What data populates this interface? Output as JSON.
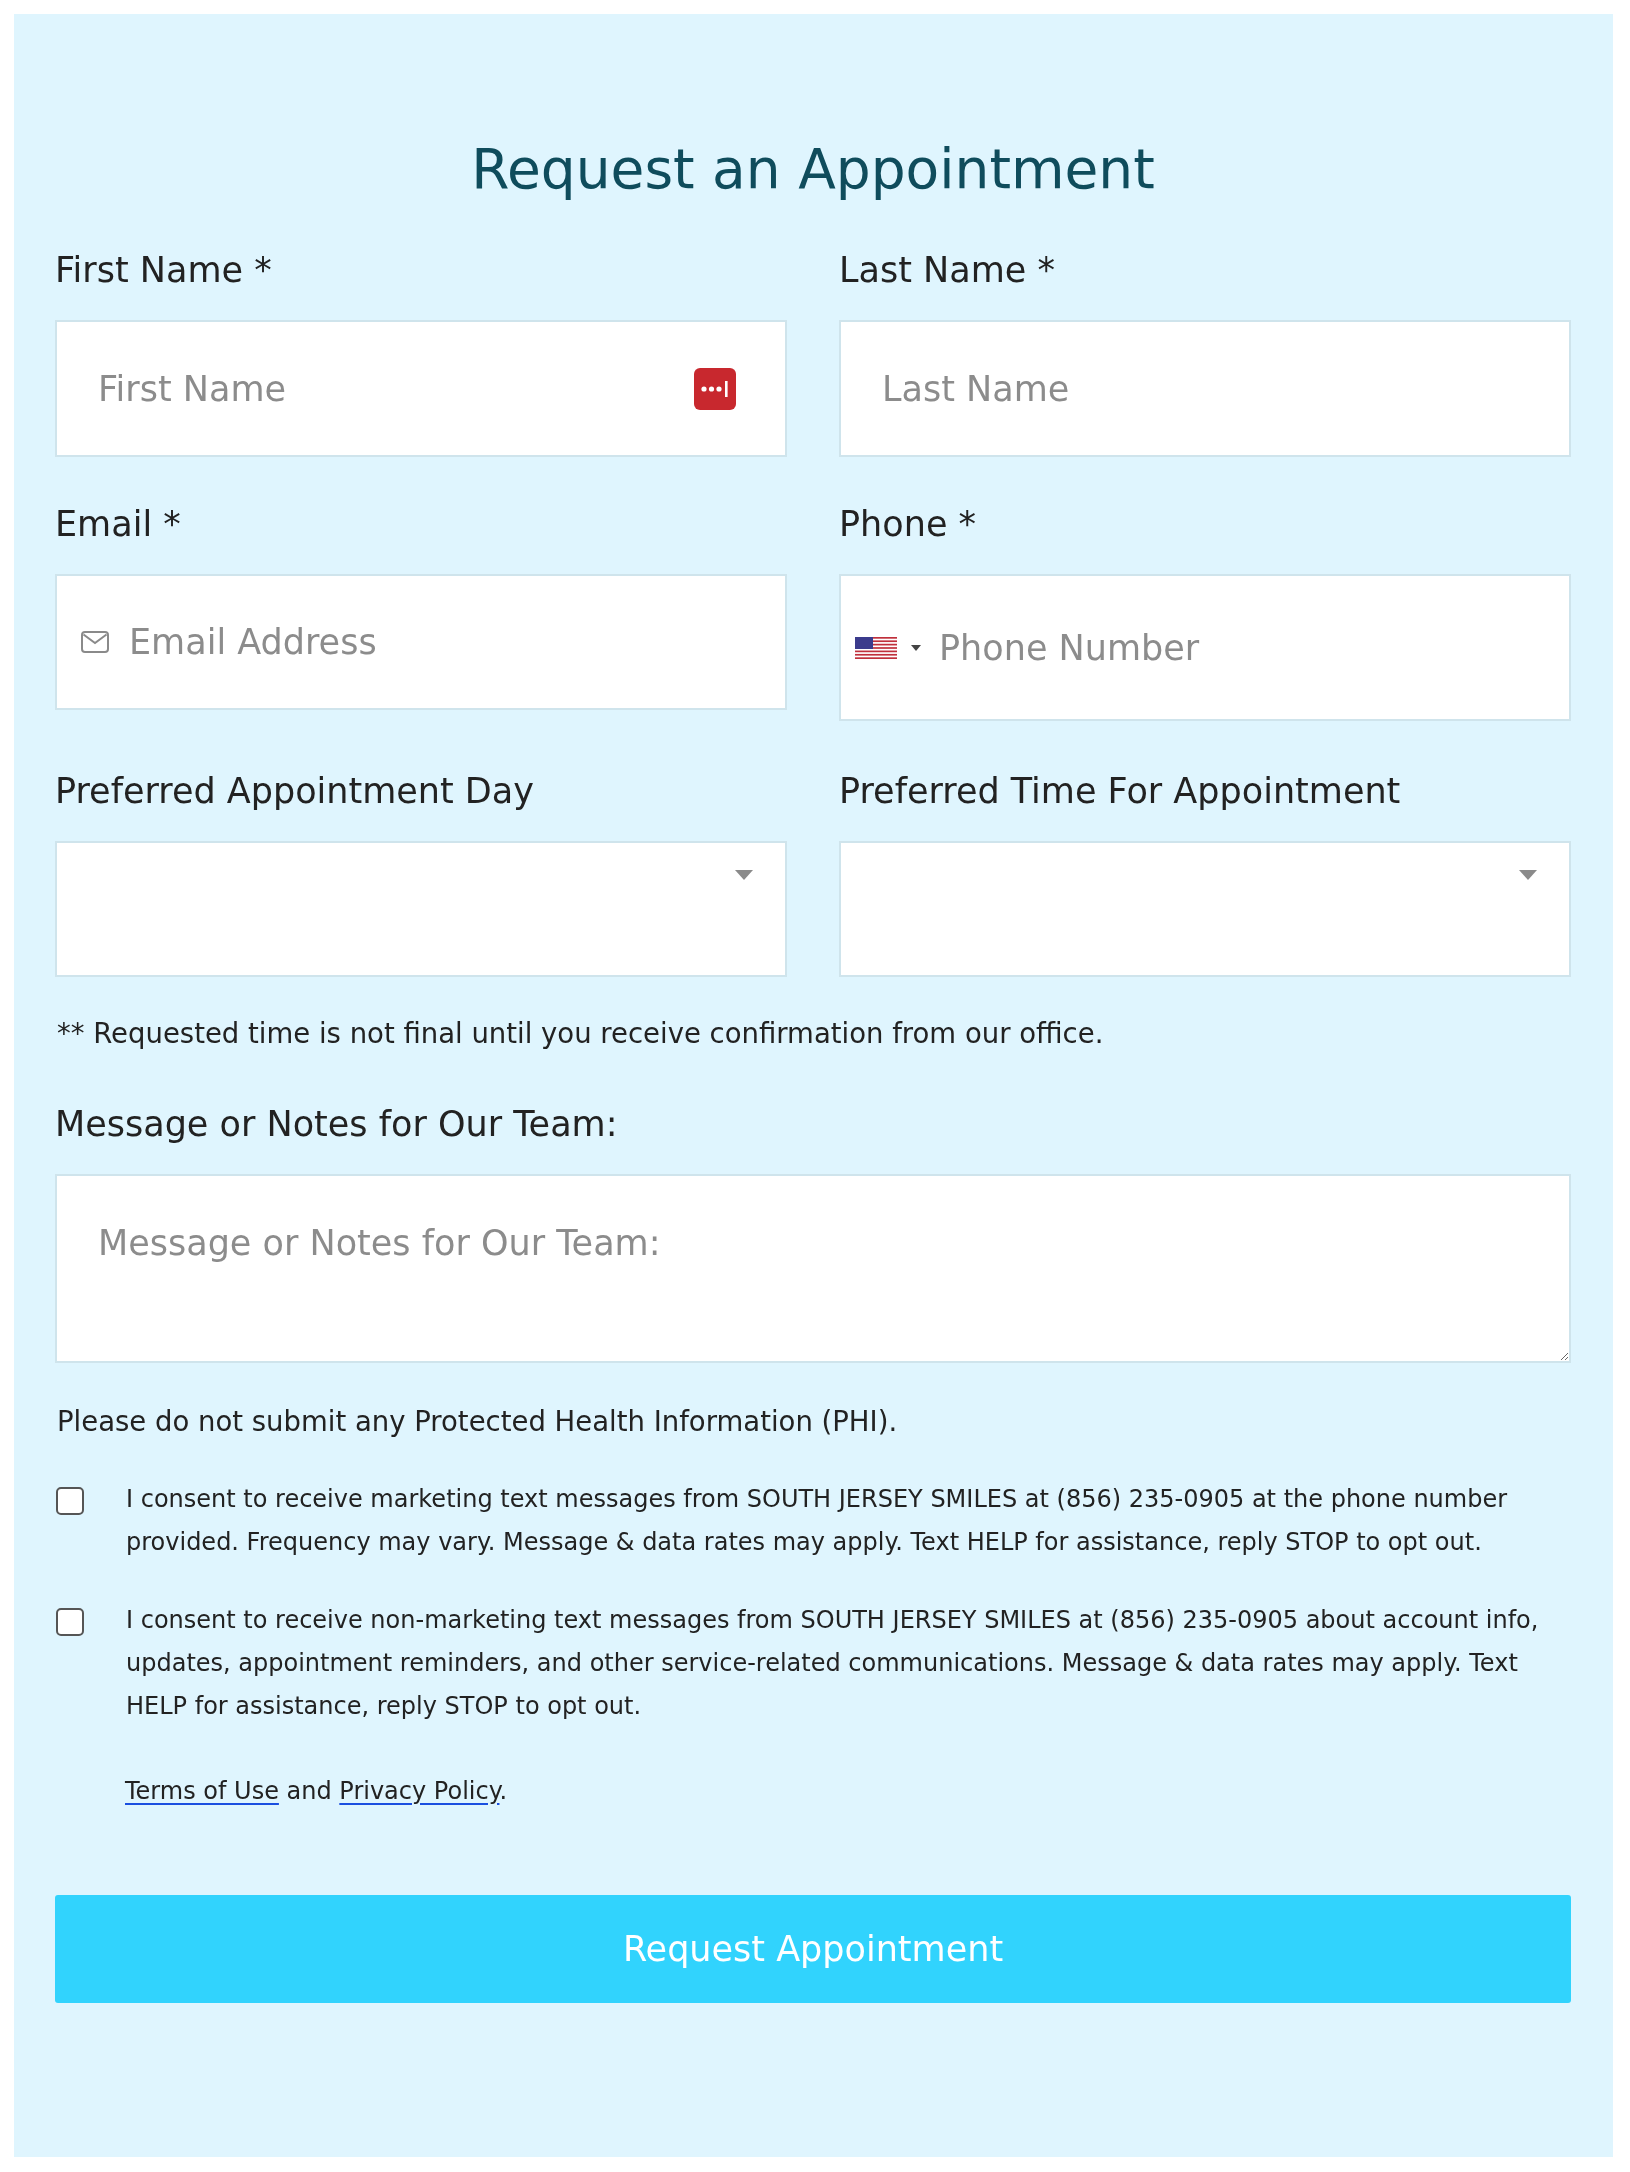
{
  "title": "Request an Appointment",
  "field_rows": [
    [
      {
        "kind": "text",
        "label": "First Name *",
        "placeholder": "First Name",
        "autofill": true
      },
      {
        "kind": "text",
        "label": "Last Name *",
        "placeholder": "Last Name"
      }
    ],
    [
      {
        "kind": "email",
        "label": "Email *",
        "placeholder": "Email Address"
      },
      {
        "kind": "phone",
        "label": "Phone *",
        "placeholder": "Phone Number"
      }
    ],
    [
      {
        "kind": "select",
        "label": "Preferred Appointment Day"
      },
      {
        "kind": "select",
        "label": "Preferred Time For Appointment"
      }
    ]
  ],
  "time_note": "** Requested time is not final until you receive confirmation from our office.",
  "message": {
    "label": "Message or Notes for Our Team:",
    "placeholder": "Message or Notes for Our Team:"
  },
  "phi_note": "Please do not submit any Protected Health Information (PHI).",
  "consents": [
    {
      "text": "I consent to receive marketing text messages from SOUTH JERSEY SMILES at (856) 235-0905 at the phone number provided. Frequency may vary. Message & data rates may apply. Text HELP for assistance, reply STOP to opt out.",
      "checked": false
    },
    {
      "text": "I consent to receive non-marketing text messages from SOUTH JERSEY SMILES at (856) 235-0905 about account info, updates, appointment reminders, and other service-related communications. Message & data rates may apply. Text HELP for assistance, reply STOP to opt out.",
      "checked": false
    }
  ],
  "legal_line": [
    {
      "kind": "link",
      "text": "Terms of Use"
    },
    {
      "kind": "text",
      "text": " and "
    },
    {
      "kind": "link",
      "text": "Privacy Policy"
    },
    {
      "kind": "text",
      "text": "."
    }
  ],
  "submit": "Request Appointment"
}
